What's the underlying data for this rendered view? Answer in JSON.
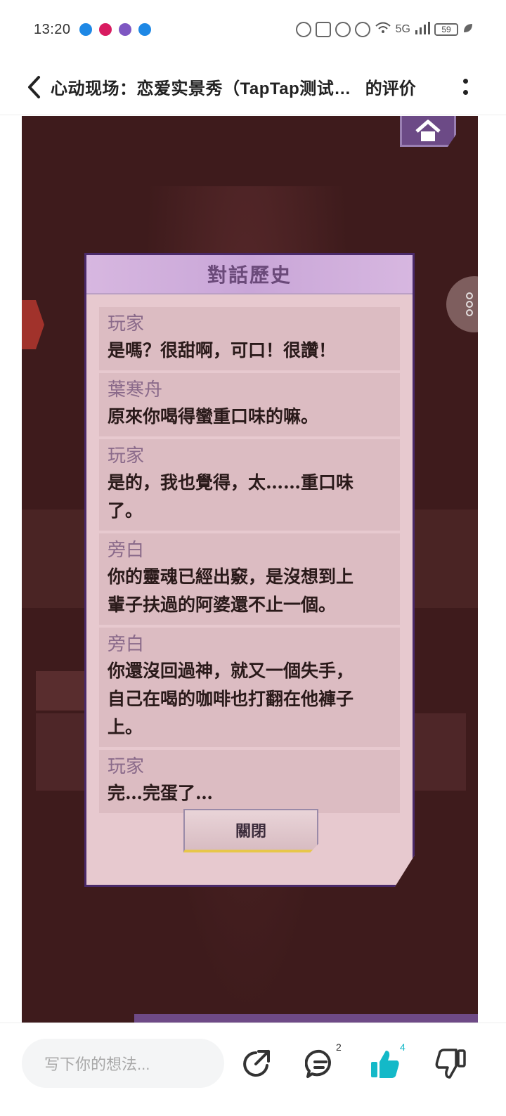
{
  "status_bar": {
    "time": "13:20",
    "network": "5G",
    "network_secondary": "6",
    "battery": "59",
    "app_icon_colors": [
      "#1e88e5",
      "#d81b60",
      "#7e57c2",
      "#1e88e5"
    ]
  },
  "header": {
    "back_icon": "chevron-left-icon",
    "title": "心动现场：恋爱实景秀（TapTap测试…",
    "suffix": "的评价",
    "more_icon": "more-vertical-icon"
  },
  "game": {
    "history_panel": {
      "title": "對話歷史",
      "entries": [
        {
          "speaker": "玩家",
          "line1": "是嗎？很甜啊，可口！很讚！"
        },
        {
          "speaker": "葉寒舟",
          "line1": "原來你喝得蠻重口味的嘛。"
        },
        {
          "speaker": "玩家",
          "line1": "是的，我也覺得，太……重口味",
          "line2": "了。"
        },
        {
          "speaker": "旁白",
          "line1": "你的靈魂已經出竅，是沒想到上",
          "line2": "輩子扶過的阿婆還不止一個。"
        },
        {
          "speaker": "旁白",
          "line1": "你還沒回過神，就又一個失手，",
          "line2": "自己在喝的咖啡也打翻在他褲子",
          "line3": "上。"
        },
        {
          "speaker": "玩家",
          "line1": "完…完蛋了…"
        }
      ],
      "close_label": "關閉"
    },
    "colors": {
      "panel_bg": "#e7c9cf",
      "panel_border": "#4a2a6a",
      "glow": "#f0d278"
    }
  },
  "bottom_bar": {
    "input_placeholder": "写下你的想法...",
    "share_icon": "share-icon",
    "comment_icon": "comment-icon",
    "comment_count": "2",
    "like_icon": "thumbs-up-icon",
    "like_count": "4",
    "dislike_icon": "thumbs-down-icon",
    "accent_color": "#14b9c8"
  }
}
